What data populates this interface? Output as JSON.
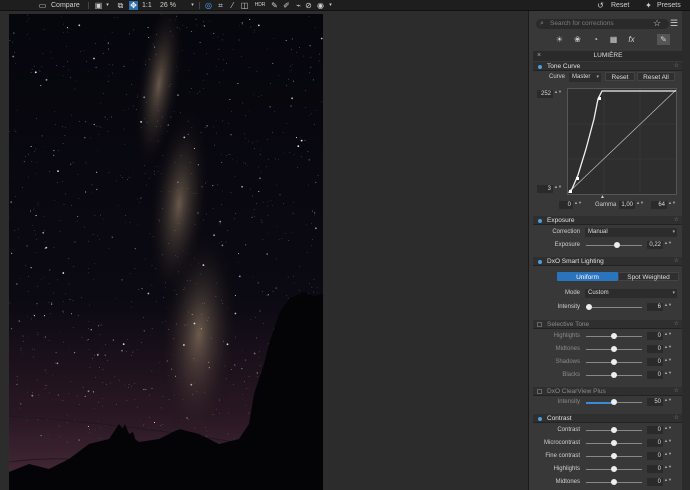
{
  "toolbar": {
    "compare_label": "Compare",
    "ratio_label": "1:1",
    "zoom_value": "26 %",
    "reset_label": "Reset",
    "presets_label": "Presets"
  },
  "panel": {
    "search_placeholder": "Search for corrections",
    "palette_name": "LUMIÈRE",
    "tone_curve": {
      "title": "Tone Curve",
      "curve_label": "Curve",
      "curve_value": "Master",
      "reset_label": "Reset",
      "reset_all_label": "Reset All",
      "top_value": "252",
      "bottom_value": "3",
      "black_in": "0",
      "gamma_label": "Gamma",
      "gamma_value": "1,00",
      "white_in": "64"
    },
    "exposure": {
      "title": "Exposure",
      "correction_label": "Correction",
      "correction_value": "Manual",
      "exposure_label": "Exposure",
      "exposure_value": "0,22",
      "exposure_level": 0.55
    },
    "smart_lighting": {
      "title": "DxO Smart Lighting",
      "mode_uniform": "Uniform",
      "mode_spot": "Spot Weighted",
      "mode_label": "Mode",
      "mode_value": "Custom",
      "intensity_label": "Intensity",
      "intensity_value": "6",
      "intensity_level": 0.06
    },
    "selective_tone": {
      "title": "Selective Tone",
      "rows": [
        {
          "label": "Highlights",
          "value": "0"
        },
        {
          "label": "Midtones",
          "value": "0"
        },
        {
          "label": "Shadows",
          "value": "0"
        },
        {
          "label": "Blacks",
          "value": "0"
        }
      ]
    },
    "clearview": {
      "title": "DxO ClearView Plus",
      "intensity_label": "Intensity",
      "intensity_value": "50",
      "intensity_level": 0.5
    },
    "contrast": {
      "title": "Contrast",
      "rows": [
        {
          "label": "Contrast",
          "value": "0"
        },
        {
          "label": "Microcontrast",
          "value": "0"
        },
        {
          "label": "Fine contrast",
          "value": "0"
        },
        {
          "label": "Highlights",
          "value": "0"
        },
        {
          "label": "Midtones",
          "value": "0"
        }
      ]
    }
  },
  "colors": {
    "accent": "#3d8ad6",
    "panel_bg": "#383838",
    "toolbar_bg": "#1e1e1e"
  }
}
